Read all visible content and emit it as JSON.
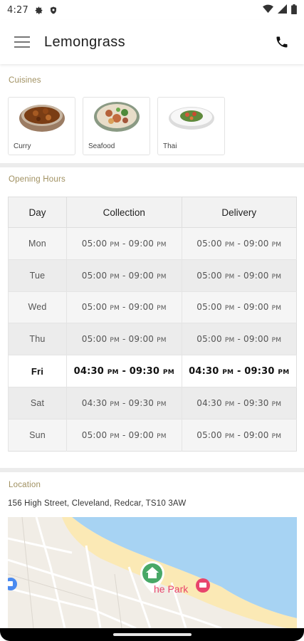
{
  "status_bar": {
    "time": "4:27"
  },
  "app_bar": {
    "title": "Lemongrass"
  },
  "cuisines": {
    "section_label": "Cuisines",
    "items": [
      {
        "label": "Curry"
      },
      {
        "label": "Seafood"
      },
      {
        "label": "Thai"
      }
    ]
  },
  "opening_hours": {
    "section_label": "Opening Hours",
    "headers": [
      "Day",
      "Collection",
      "Delivery"
    ],
    "rows": [
      {
        "day": "Mon",
        "collection_open": "05:00",
        "collection_close": "09:00",
        "delivery_open": "05:00",
        "delivery_close": "09:00"
      },
      {
        "day": "Tue",
        "collection_open": "05:00",
        "collection_close": "09:00",
        "delivery_open": "05:00",
        "delivery_close": "09:00"
      },
      {
        "day": "Wed",
        "collection_open": "05:00",
        "collection_close": "09:00",
        "delivery_open": "05:00",
        "delivery_close": "09:00"
      },
      {
        "day": "Thu",
        "collection_open": "05:00",
        "collection_close": "09:00",
        "delivery_open": "05:00",
        "delivery_close": "09:00"
      },
      {
        "day": "Fri",
        "collection_open": "04:30",
        "collection_close": "09:30",
        "delivery_open": "04:30",
        "delivery_close": "09:30"
      },
      {
        "day": "Sat",
        "collection_open": "04:30",
        "collection_close": "09:30",
        "delivery_open": "04:30",
        "delivery_close": "09:30"
      },
      {
        "day": "Sun",
        "collection_open": "05:00",
        "collection_close": "09:00",
        "delivery_open": "05:00",
        "delivery_close": "09:00"
      }
    ],
    "pm_label": "PM",
    "separator": " - "
  },
  "location": {
    "section_label": "Location",
    "address": "156 High Street, Cleveland, Redcar, TS10 3AW",
    "map_label": "he Park"
  },
  "colors": {
    "section_label": "#a09060",
    "sea": "#a7d3f3",
    "sand": "#fbe9b5",
    "marker": "#48a867",
    "poi": "#e8446c"
  }
}
